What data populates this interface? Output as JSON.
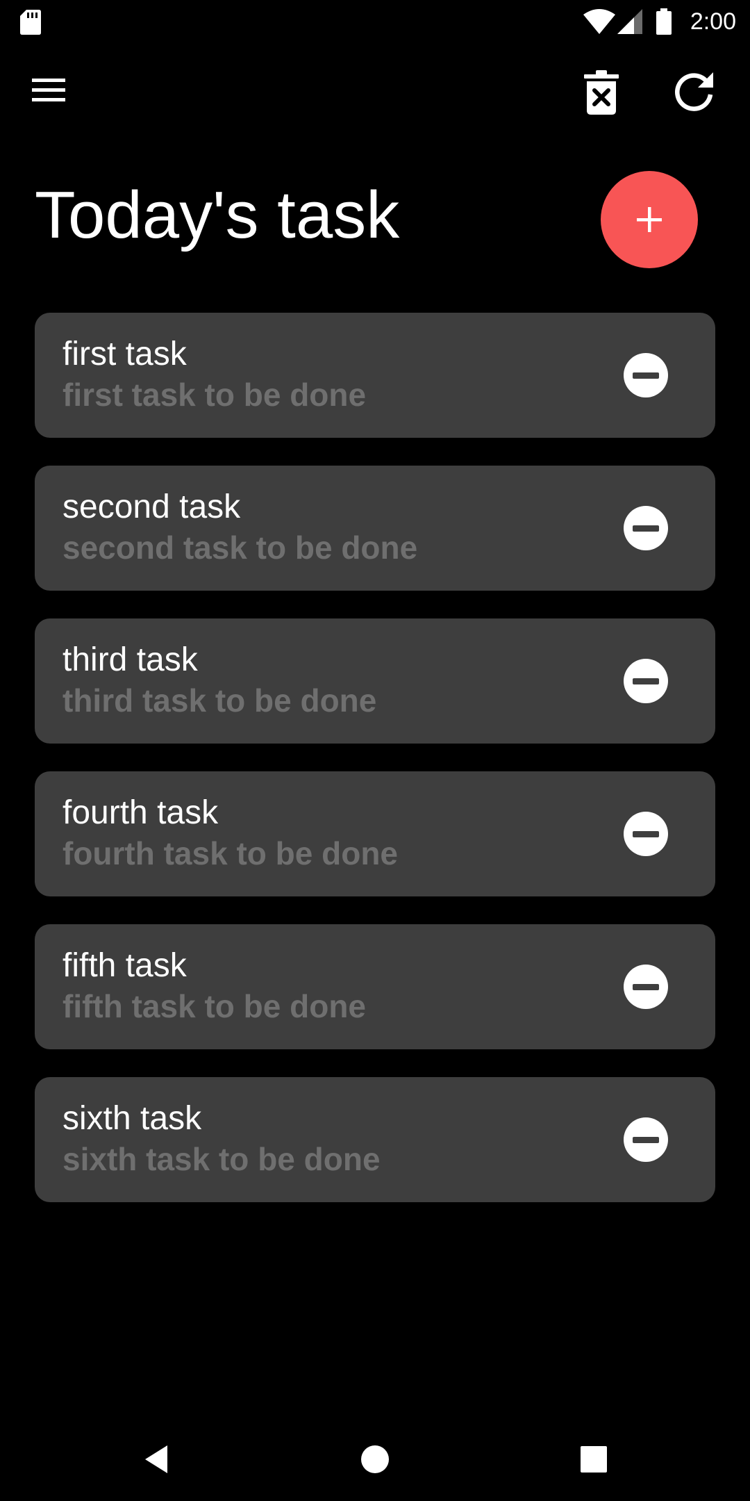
{
  "status_bar": {
    "time": "2:00",
    "icons": [
      "sd-card-icon",
      "wifi-icon",
      "signal-icon",
      "battery-icon"
    ]
  },
  "toolbar": {
    "menu_icon": "hamburger-menu-icon",
    "delete_all_icon": "trash-x-icon",
    "refresh_icon": "refresh-icon"
  },
  "header": {
    "title": "Today's task",
    "add_button_icon": "plus-icon"
  },
  "colors": {
    "background": "#000000",
    "card": "#3e3e3e",
    "accent": "#f85555",
    "subtitle": "#6f6f6f"
  },
  "tasks": [
    {
      "title": "first task",
      "description": "first task to be done"
    },
    {
      "title": "second task",
      "description": "second task to be done"
    },
    {
      "title": "third task",
      "description": "third task to be done"
    },
    {
      "title": "fourth task",
      "description": "fourth task to be done"
    },
    {
      "title": "fifth task",
      "description": "fifth task to be done"
    },
    {
      "title": "sixth task",
      "description": "sixth task to be done"
    }
  ],
  "nav_bar": {
    "icons": [
      "back-icon",
      "home-icon",
      "recents-icon"
    ]
  }
}
